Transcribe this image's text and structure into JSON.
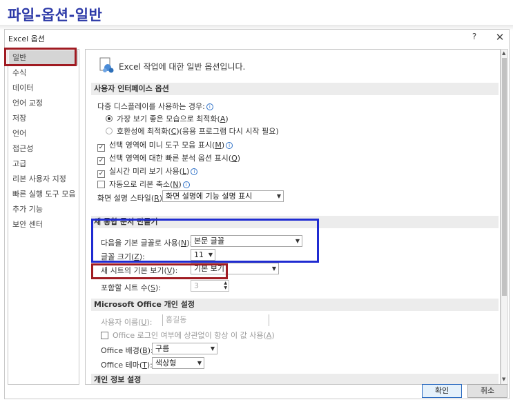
{
  "caption": "파일-옵션-일반",
  "dialog": {
    "title": "Excel 옵션",
    "help": "?",
    "close": "✕"
  },
  "nav": {
    "items": [
      {
        "label": "일반",
        "selected": true
      },
      {
        "label": "수식"
      },
      {
        "label": "데이터"
      },
      {
        "label": "언어 교정"
      },
      {
        "label": "저장"
      },
      {
        "label": "언어"
      },
      {
        "label": "접근성"
      },
      {
        "label": "고급"
      },
      {
        "label": "리본 사용자 지정"
      },
      {
        "label": "빠른 실행 도구 모음"
      },
      {
        "label": "추가 기능"
      },
      {
        "label": "보안 센터"
      }
    ]
  },
  "intro": {
    "text": "Excel 작업에 대한 일반 옵션입니다."
  },
  "ui_options": {
    "header": "사용자 인터페이스 옵션",
    "multi_display_label": "다중 디스플레이를 사용하는 경우:",
    "radio_best_appearance": {
      "prefix": "가장 보기 좋은 모습으로 최적화(",
      "key": "A",
      "suffix": ")"
    },
    "radio_compat": {
      "prefix": "호환성에 최적화(",
      "key": "C",
      "suffix": ")(응용 프로그램 다시 시작 필요)"
    },
    "chk_mini_toolbar": {
      "prefix": "선택 영역에 미니 도구 모음 표시(",
      "key": "M",
      "suffix": ")"
    },
    "chk_quick_analysis": {
      "prefix": "선택 영역에 대한 빠른 분석 옵션 표시(",
      "key": "Q",
      "suffix": ")"
    },
    "chk_live_preview": {
      "prefix": "실시간 미리 보기 사용(",
      "key": "L",
      "suffix": ")"
    },
    "chk_collapse_ribbon": {
      "prefix": "자동으로 리본 축소(",
      "key": "N",
      "suffix": ")"
    },
    "screentip_label": {
      "prefix": "화면 설명 스타일(",
      "key": "R",
      "suffix": "):"
    },
    "screentip_value": "화면 설명에 기능 설명 표시"
  },
  "new_workbook": {
    "header": "새 통합 문서 만들기",
    "font_label": {
      "prefix": "다음을 기본 글꼴로 사용(",
      "key": "N",
      "suffix": "):"
    },
    "font_value": "본문 글꼴",
    "size_label": {
      "prefix": "글꼴 크기(",
      "key": "Z",
      "suffix": "):"
    },
    "size_value": "11",
    "view_label": {
      "prefix": "새 시트의 기본 보기(",
      "key": "V",
      "suffix": "):"
    },
    "view_value": "기본 보기",
    "sheets_label": {
      "prefix": "포함할 시트 수(",
      "key": "S",
      "suffix": "):"
    },
    "sheets_value": "3"
  },
  "personalize": {
    "header": "Microsoft Office 개인 설정",
    "username_label": {
      "prefix": "사용자 이름(",
      "key": "U",
      "suffix": "):"
    },
    "username_value": "홍길동",
    "chk_always_use": {
      "prefix": "Office 로그인 여부에 상관없이 항상 이 값 사용(",
      "key": "A",
      "suffix": ")"
    },
    "background_label": {
      "prefix": "Office 배경(",
      "key": "B",
      "suffix": "):"
    },
    "background_value": "구름",
    "theme_label": {
      "prefix": "Office 테마(",
      "key": "T",
      "suffix": "):"
    },
    "theme_value": "색상형"
  },
  "privacy": {
    "header": "개인 정보 설정"
  },
  "footer": {
    "ok": "확인",
    "cancel": "취소"
  },
  "colors": {
    "caption": "#2d3aa8",
    "highlight_red": "#a01b22",
    "highlight_blue": "#1f2bd1"
  }
}
